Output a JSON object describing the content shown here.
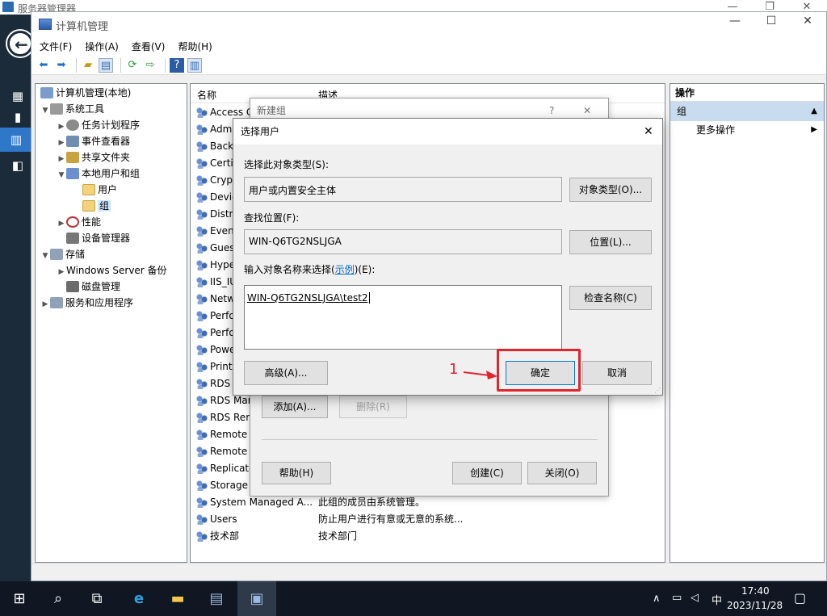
{
  "server_manager": {
    "title": "服务器管理器",
    "controls": {
      "minimize": "—",
      "restore": "❐",
      "close": "✕"
    }
  },
  "window": {
    "title": "计算机管理",
    "controls": {
      "minimize": "—",
      "maximize": "☐",
      "close": "✕"
    },
    "menu": [
      "文件(F)",
      "操作(A)",
      "查看(V)",
      "帮助(H)"
    ]
  },
  "tree": {
    "root": "计算机管理(本地)",
    "system_tools": "系统工具",
    "task_scheduler": "任务计划程序",
    "event_viewer": "事件查看器",
    "shared_folders": "共享文件夹",
    "local_users_groups": "本地用户和组",
    "users": "用户",
    "groups": "组",
    "performance": "性能",
    "device_manager": "设备管理器",
    "storage": "存储",
    "windows_backup": "Windows Server 备份",
    "disk_management": "磁盘管理",
    "services_apps": "服务和应用程序"
  },
  "list": {
    "col_name": "名称",
    "col_desc": "描述",
    "rows": [
      {
        "name": "Access C",
        "desc": ""
      },
      {
        "name": "Adm",
        "desc": ""
      },
      {
        "name": "Back",
        "desc": ""
      },
      {
        "name": "Certi",
        "desc": ""
      },
      {
        "name": "Cryp",
        "desc": ""
      },
      {
        "name": "Devic",
        "desc": ""
      },
      {
        "name": "Distri",
        "desc": ""
      },
      {
        "name": "Event",
        "desc": ""
      },
      {
        "name": "Gues",
        "desc": ""
      },
      {
        "name": "Hype",
        "desc": ""
      },
      {
        "name": "IIS_IU",
        "desc": ""
      },
      {
        "name": "Netw",
        "desc": ""
      },
      {
        "name": "Perfo",
        "desc": ""
      },
      {
        "name": "Perfo",
        "desc": ""
      },
      {
        "name": "Powe",
        "desc": ""
      },
      {
        "name": "Print",
        "desc": ""
      },
      {
        "name": "RDS",
        "desc": ""
      },
      {
        "name": "RDS Mar",
        "desc": ""
      },
      {
        "name": "RDS Rem",
        "desc": ""
      },
      {
        "name": "Remote I",
        "desc": ""
      },
      {
        "name": "Remote I",
        "desc": ""
      },
      {
        "name": "Replicato",
        "desc": ""
      },
      {
        "name": "Storage",
        "desc": ""
      },
      {
        "name": "System Managed A...",
        "desc": "此组的成员由系统管理。"
      },
      {
        "name": "Users",
        "desc": "防止用户进行有意或无意的系统..."
      },
      {
        "name": "技术部",
        "desc": "技术部门"
      }
    ]
  },
  "actions": {
    "header": "操作",
    "group": "组",
    "more": "更多操作"
  },
  "new_group_dialog": {
    "title": "新建组",
    "help": "?",
    "close": "✕",
    "add": "添加(A)...",
    "remove": "删除(R)",
    "help_btn": "帮助(H)",
    "create": "创建(C)",
    "close_btn": "关闭(O)"
  },
  "select_users_dialog": {
    "title": "选择用户",
    "close": "✕",
    "object_type_label": "选择此对象类型(S):",
    "object_type_value": "用户或内置安全主体",
    "object_type_btn": "对象类型(O)...",
    "location_label": "查找位置(F):",
    "location_value": "WIN-Q6TG2NSLJGA",
    "location_btn": "位置(L)...",
    "names_label_pre": "输入对象名称来选择(",
    "names_label_link": "示例",
    "names_label_post": ")(E):",
    "names_value": "WIN-Q6TG2NSLJGA\\test2",
    "check_names_btn": "检查名称(C)",
    "advanced_btn": "高级(A)...",
    "ok_btn": "确定",
    "cancel_btn": "取消"
  },
  "annotation": {
    "number": "1",
    "color": "#e0262b"
  },
  "taskbar": {
    "time": "17:40",
    "date": "2023/11/28",
    "ime": "中"
  }
}
